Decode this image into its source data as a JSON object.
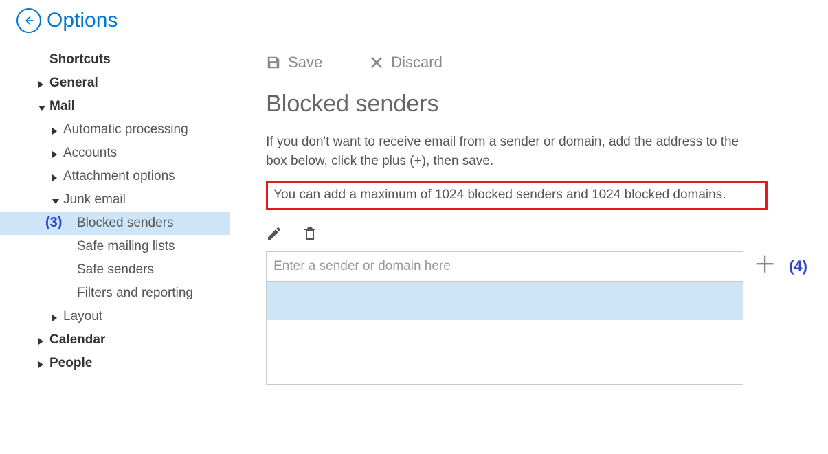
{
  "header": {
    "title": "Options"
  },
  "sidebar": {
    "shortcuts_label": "Shortcuts",
    "general_label": "General",
    "mail_label": "Mail",
    "mail_children": {
      "automatic_processing": "Automatic processing",
      "accounts": "Accounts",
      "attachment_options": "Attachment options",
      "junk_email": "Junk email",
      "junk_children": {
        "blocked_senders": "Blocked senders",
        "safe_mailing_lists": "Safe mailing lists",
        "safe_senders": "Safe senders",
        "filters_and_reporting": "Filters and reporting"
      },
      "layout": "Layout"
    },
    "calendar_label": "Calendar",
    "people_label": "People"
  },
  "annotations": {
    "sidebar_selected": "(3)",
    "add_button": "(4)"
  },
  "toolbar": {
    "save_label": "Save",
    "discard_label": "Discard"
  },
  "page": {
    "title": "Blocked senders",
    "description": "If you don't want to receive email from a sender or domain, add the address to the box below, click the plus (+), then save.",
    "limit_notice": "You can add a maximum of 1024 blocked senders and 1024 blocked domains.",
    "input_placeholder": "Enter a sender or domain here"
  }
}
